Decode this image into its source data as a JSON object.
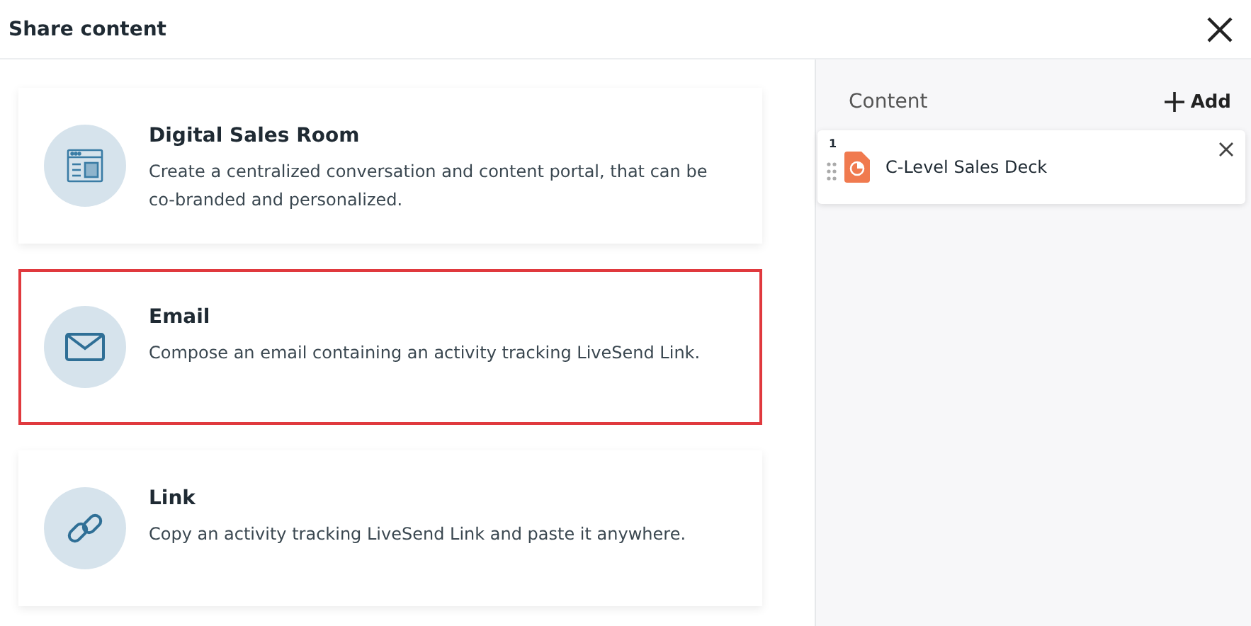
{
  "dialog": {
    "title": "Share content"
  },
  "options": [
    {
      "kind": "room",
      "title": "Digital Sales Room",
      "description": "Create a centralized conversation and content portal, that can be co-branded and personalized.",
      "selected": false
    },
    {
      "kind": "email",
      "title": "Email",
      "description": "Compose an email containing an activity tracking LiveSend Link.",
      "selected": true
    },
    {
      "kind": "link",
      "title": "Link",
      "description": "Copy an activity tracking LiveSend Link and paste it anywhere.",
      "selected": false
    }
  ],
  "content": {
    "heading": "Content",
    "add_label": "Add",
    "items": [
      {
        "number": "1",
        "name": "C-Level Sales Deck"
      }
    ]
  }
}
